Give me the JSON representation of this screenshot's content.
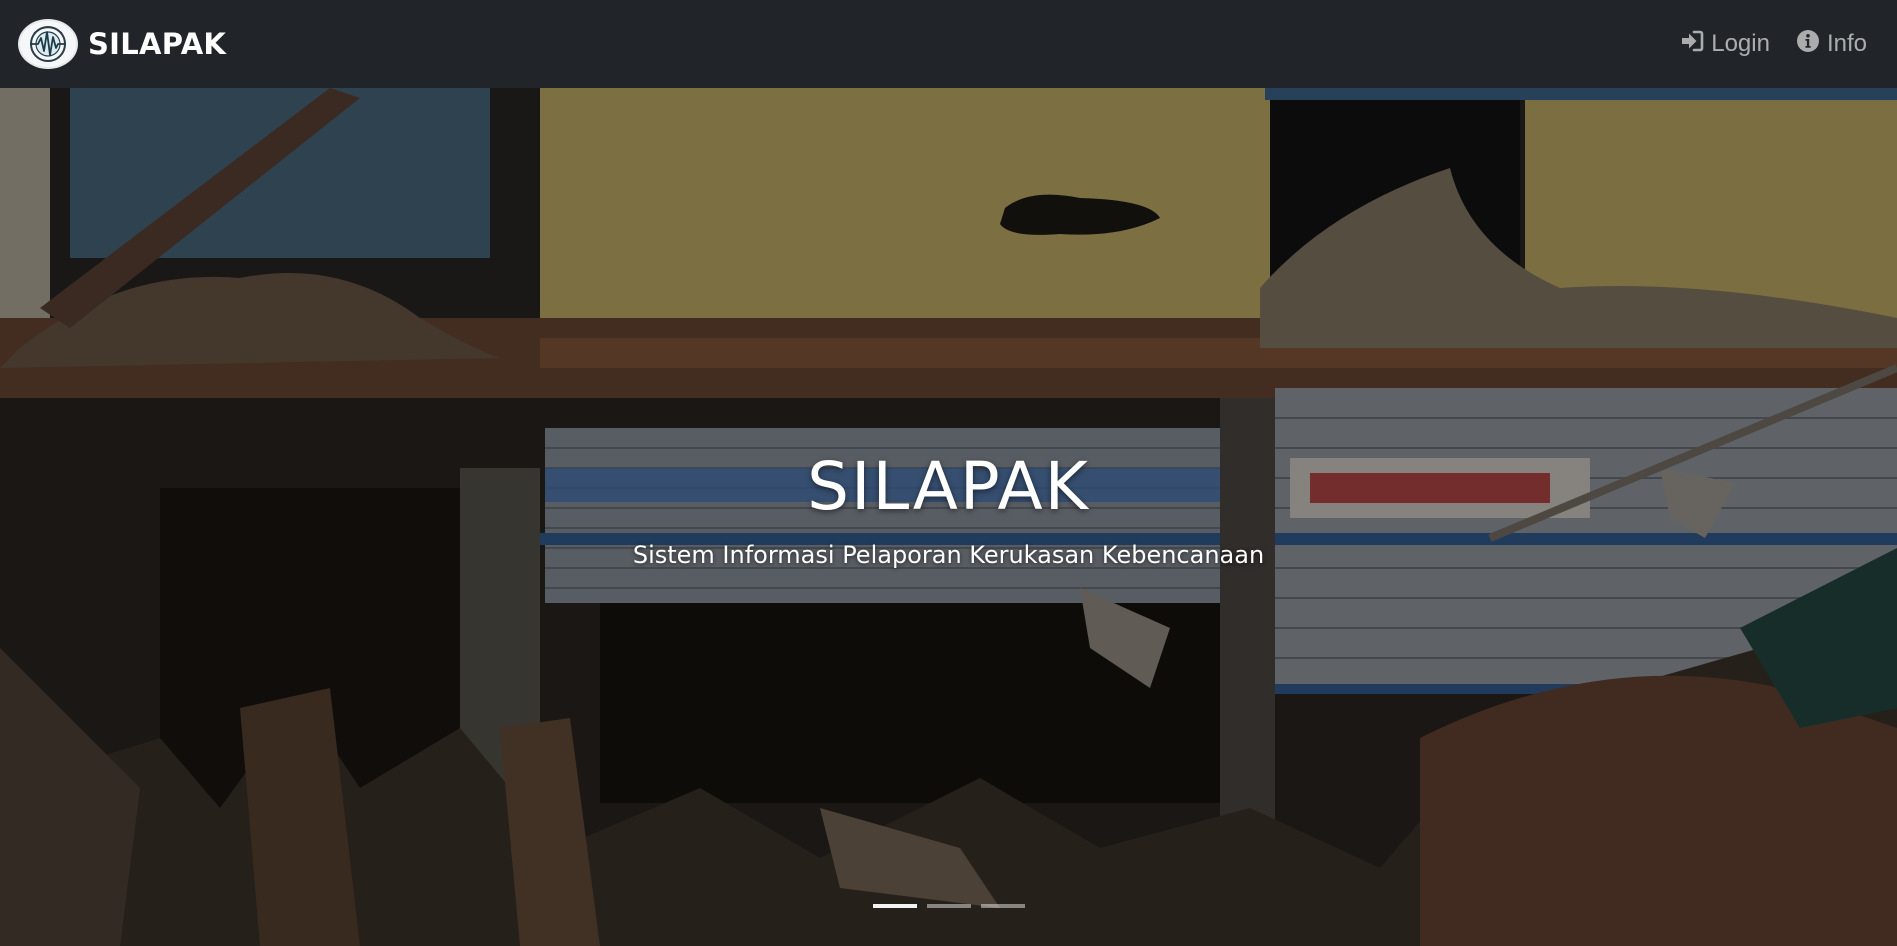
{
  "navbar": {
    "brand": "SILAPAK",
    "logo_icon": "seismograph-icon",
    "links": [
      {
        "label": "Login",
        "icon": "sign-in-icon"
      },
      {
        "label": "Info",
        "icon": "info-circle-icon"
      }
    ],
    "background": "#212529",
    "link_color": "rgba(255,255,255,0.62)"
  },
  "hero": {
    "title": "SILAPAK",
    "subtitle": "Sistem Informasi Pelaporan Kerukasan Kebencanaan",
    "image_description_icon": "earthquake-damaged-building-photo",
    "indicators": [
      {
        "active": true
      },
      {
        "active": false
      },
      {
        "active": false
      }
    ]
  }
}
